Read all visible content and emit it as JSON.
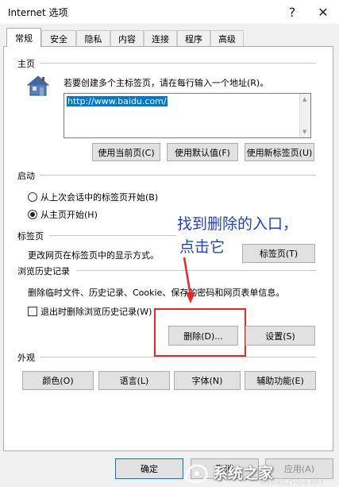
{
  "window": {
    "title": "Internet 选项",
    "help": "?",
    "close": "✕"
  },
  "tabs": [
    {
      "label": "常规",
      "active": true
    },
    {
      "label": "安全"
    },
    {
      "label": "隐私"
    },
    {
      "label": "内容"
    },
    {
      "label": "连接"
    },
    {
      "label": "程序"
    },
    {
      "label": "高级"
    }
  ],
  "home": {
    "heading": "主页",
    "description": "若要创建多个主标签页，请在每行输入一个地址(R)。",
    "url_value": "http://www.baidu.com/",
    "btn_current": "使用当前页(C)",
    "btn_default": "使用默认值(F)",
    "btn_newtab": "使用新标签页(U)"
  },
  "startup": {
    "heading": "启动",
    "option_last": "从上次会话中的标签页开始(B)",
    "option_home": "从主页开始(H)",
    "selected": "option_home"
  },
  "tabs_section": {
    "heading": "标签页",
    "description": "更改网页在标签页中的显示方式。",
    "button": "标签页(T)"
  },
  "history": {
    "heading": "浏览历史记录",
    "description": "删除临时文件、历史记录、Cookie、保存的密码和网页表单信息。",
    "checkbox_label": "退出时删除浏览历史记录(W)",
    "checked": false,
    "delete_button": "删除(D)...",
    "settings_button": "设置(S)"
  },
  "appearance": {
    "heading": "外观",
    "colors": "颜色(O)",
    "languages": "语言(L)",
    "fonts": "字体(N)",
    "accessibility": "辅助功能(E)"
  },
  "footer": {
    "ok": "确定",
    "cancel": "取消",
    "apply": "应用(A)"
  },
  "annotation": {
    "line1": "找到删除的入口，",
    "line2": "点击它",
    "color": "#1f3fd0",
    "box_color": "#e8262b"
  },
  "watermark": {
    "text": "系统之家",
    "url": "XITONGZHIJIA.NET"
  }
}
